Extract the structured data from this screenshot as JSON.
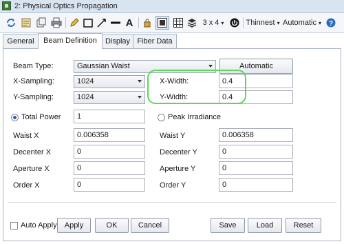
{
  "window": {
    "title": "2: Physical Optics Propagation"
  },
  "toolbar": {
    "icon_size": "3 x 4",
    "line_style": "Thinnest",
    "scale_mode": "Automatic"
  },
  "tabs": [
    {
      "label": "General"
    },
    {
      "label": "Beam Definition"
    },
    {
      "label": "Display"
    },
    {
      "label": "Fiber Data"
    }
  ],
  "beam": {
    "type_label": "Beam Type:",
    "type_value": "Gaussian Waist",
    "automatic_label": "Automatic",
    "xsampling_label": "X-Sampling:",
    "xsampling_value": "1024",
    "ysampling_label": "Y-Sampling:",
    "ysampling_value": "1024",
    "xwidth_label": "X-Width:",
    "xwidth_value": "0.4",
    "ywidth_label": "Y-Width:",
    "ywidth_value": "0.4",
    "total_power_label": "Total Power",
    "total_power_value": "1",
    "peak_irradiance_label": "Peak Irradiance",
    "waist_x_label": "Waist X",
    "waist_x_value": "0.006358",
    "waist_y_label": "Waist Y",
    "waist_y_value": "0.006358",
    "decenter_x_label": "Decenter X",
    "decenter_x_value": "0",
    "decenter_y_label": "Decenter Y",
    "decenter_y_value": "0",
    "aperture_x_label": "Aperture X",
    "aperture_x_value": "0",
    "aperture_y_label": "Aperture Y",
    "aperture_y_value": "0",
    "order_x_label": "Order X",
    "order_x_value": "0",
    "order_y_label": "Order Y",
    "order_y_value": "0"
  },
  "footer": {
    "auto_apply_label": "Auto Apply",
    "apply_label": "Apply",
    "ok_label": "OK",
    "cancel_label": "Cancel",
    "save_label": "Save",
    "load_label": "Load",
    "reset_label": "Reset"
  },
  "colors": {
    "highlight": "#5cd65c",
    "accent": "#2e5fa6"
  }
}
